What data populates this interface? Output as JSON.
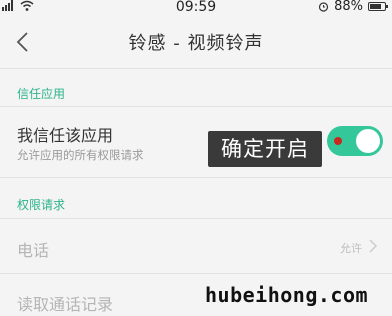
{
  "status_bar": {
    "time": "09:59",
    "battery_percent": "88%",
    "battery_level": 0.88
  },
  "header": {
    "title": "铃感 - 视频铃声"
  },
  "sections": {
    "trust": {
      "header": "信任应用",
      "row": {
        "title": "我信任该应用",
        "subtitle": "允许应用的所有权限请求",
        "toggle_on": true
      }
    },
    "permissions": {
      "header": "权限请求",
      "rows": [
        {
          "title": "电话",
          "value": "允许"
        },
        {
          "title": "读取通话记录",
          "value": ""
        }
      ]
    }
  },
  "callout": {
    "text": "确定开启"
  },
  "watermark": {
    "text": "hubeihong.com"
  },
  "colors": {
    "accent": "#2bb38a",
    "toggle_on": "#34c79a",
    "callout_bg": "#3a3a3a"
  },
  "icons": [
    "signal-icon",
    "wifi-icon",
    "alarm-icon",
    "battery-icon",
    "back-arrow-icon",
    "chevron-right-icon"
  ]
}
